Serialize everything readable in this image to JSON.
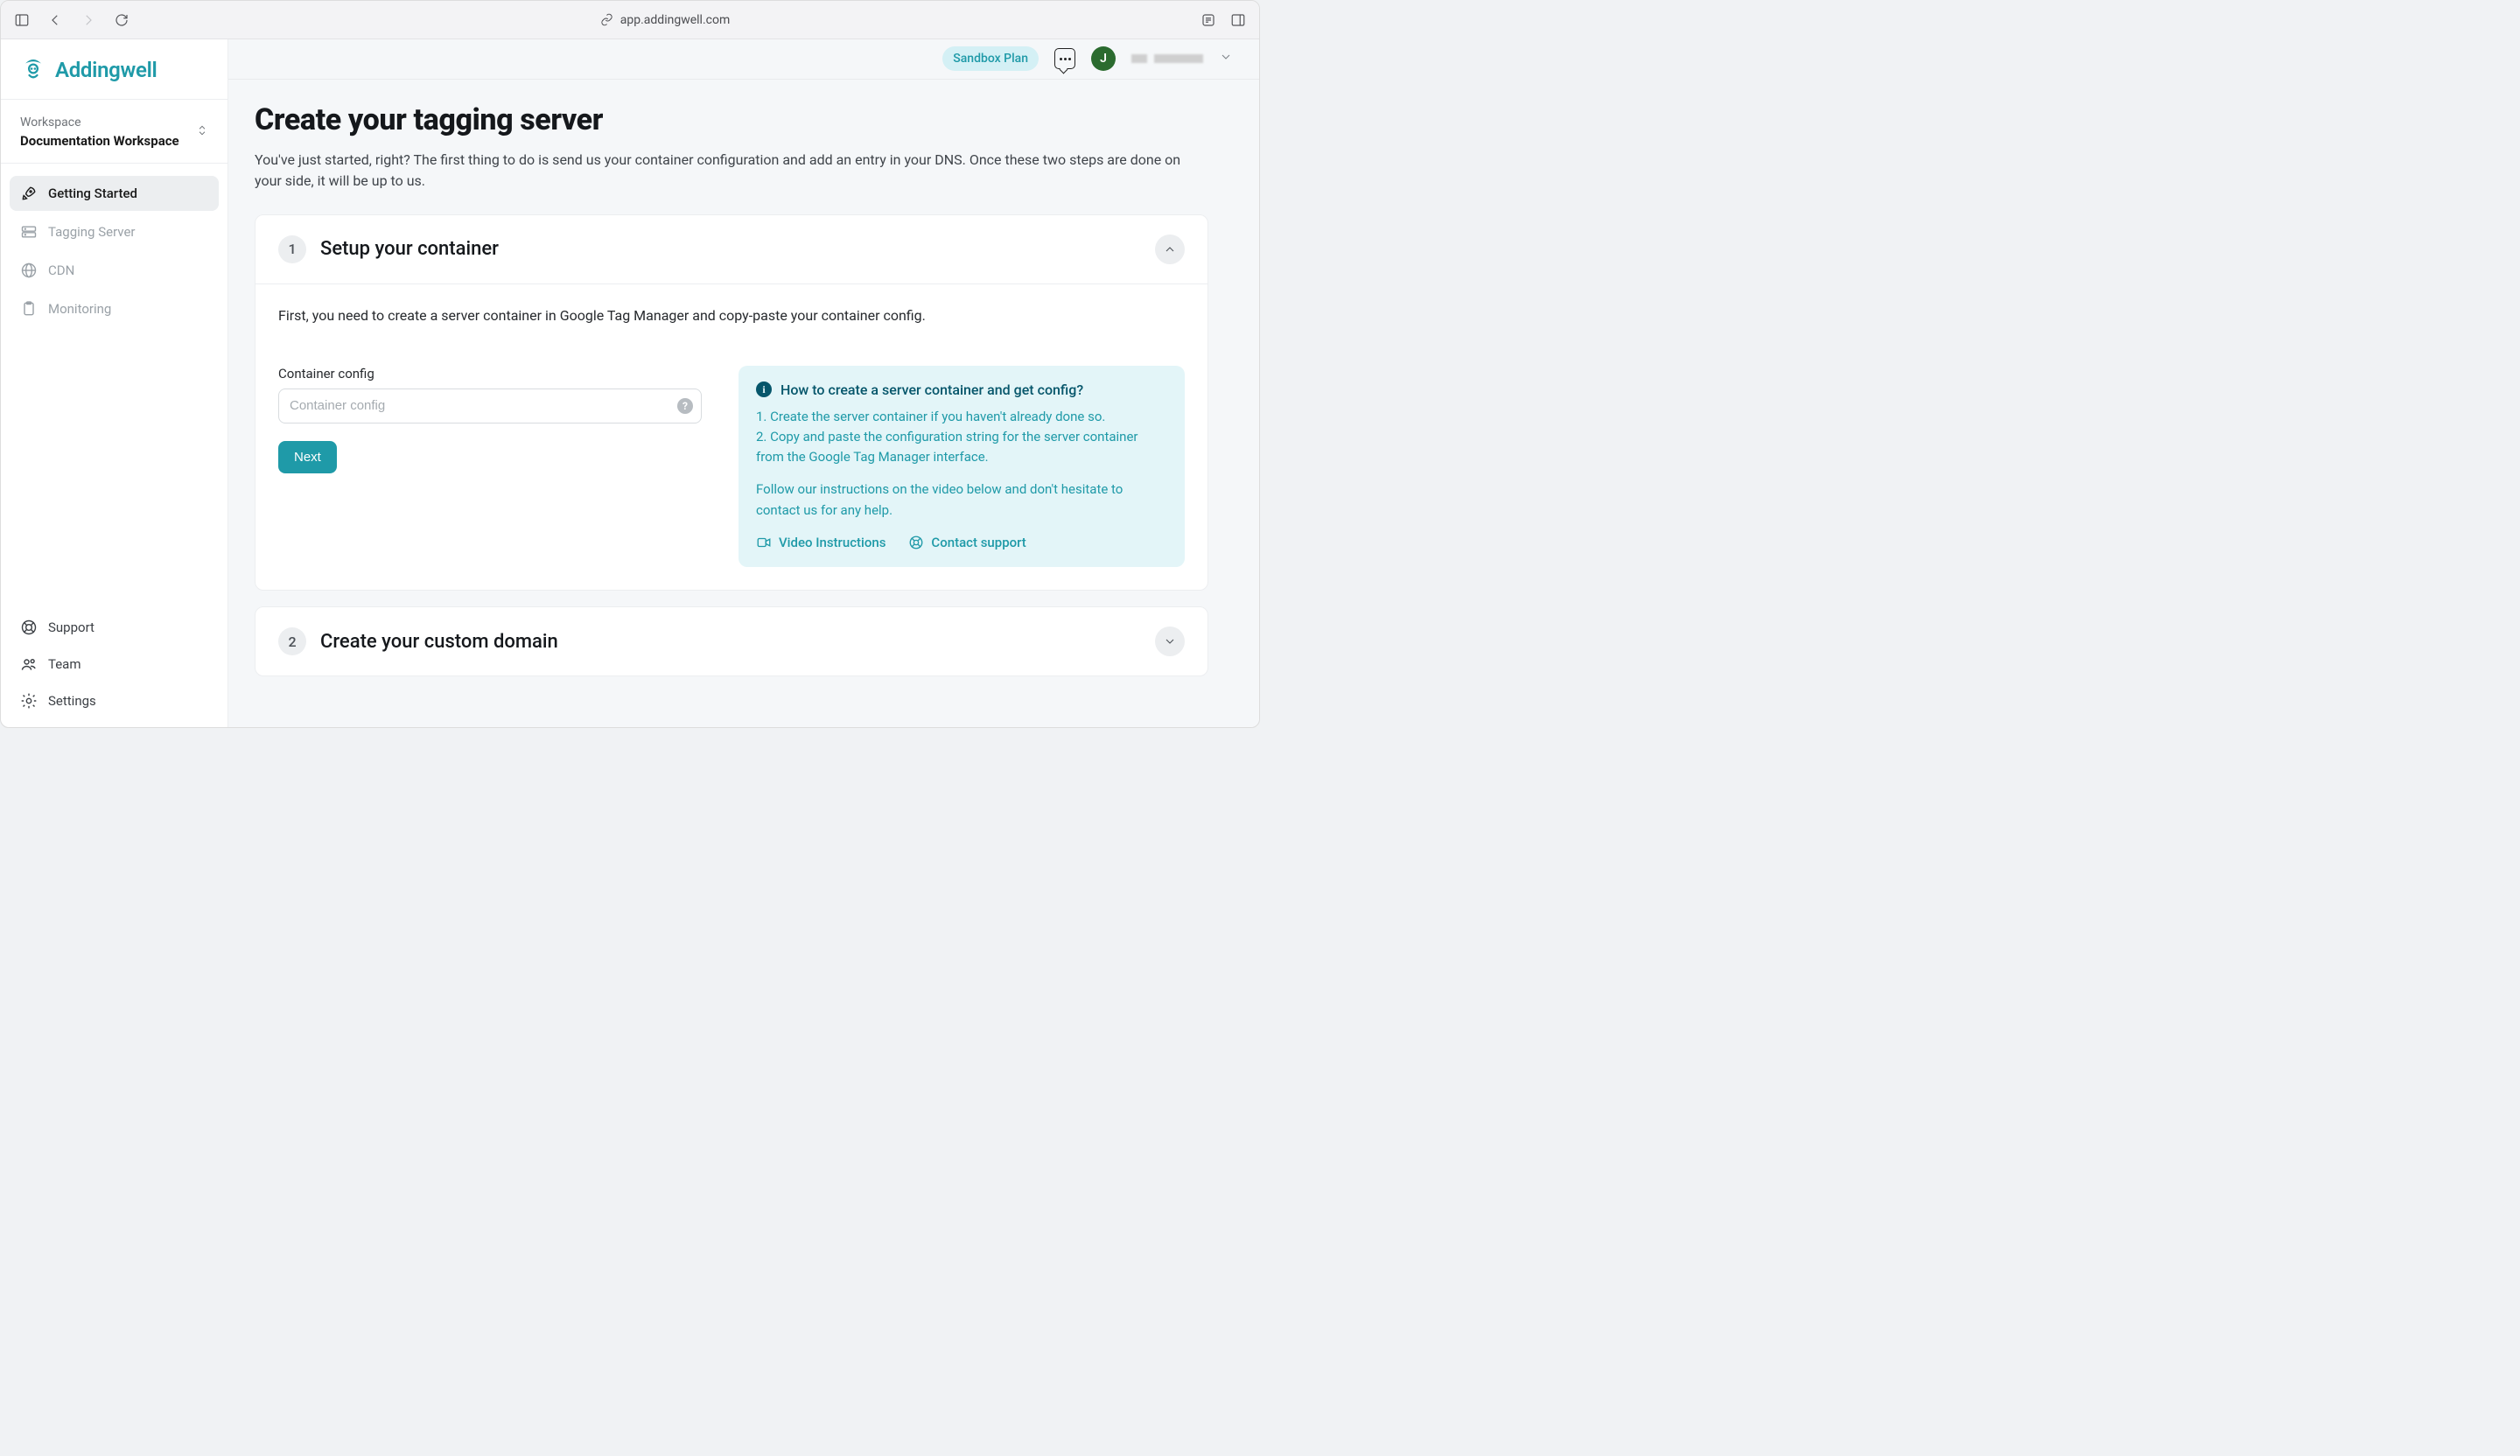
{
  "browser": {
    "url": "app.addingwell.com"
  },
  "brand": {
    "name": "Addingwell",
    "accent": "#1f9aa8"
  },
  "workspace": {
    "label": "Workspace",
    "name": "Documentation Workspace"
  },
  "nav": {
    "items": [
      {
        "id": "getting-started",
        "label": "Getting Started",
        "active": true
      },
      {
        "id": "tagging-server",
        "label": "Tagging Server",
        "active": false
      },
      {
        "id": "cdn",
        "label": "CDN",
        "active": false
      },
      {
        "id": "monitoring",
        "label": "Monitoring",
        "active": false
      }
    ],
    "bottom": [
      {
        "id": "support",
        "label": "Support"
      },
      {
        "id": "team",
        "label": "Team"
      },
      {
        "id": "settings",
        "label": "Settings"
      }
    ]
  },
  "topbar": {
    "plan": "Sandbox Plan",
    "avatar_initial": "J"
  },
  "page": {
    "title": "Create your tagging server",
    "subtitle": "You've just started, right? The first thing to do is send us your container configuration and add an entry in your DNS. Once these two steps are done on your side, it will be up to us."
  },
  "steps": [
    {
      "num": "1",
      "title": "Setup your container",
      "expanded": true,
      "intro": "First, you need to create a server container in Google Tag Manager and copy-paste your container config.",
      "field_label": "Container config",
      "placeholder": "Container config",
      "next_label": "Next",
      "help": {
        "heading": "How to create a server container and get config?",
        "line1": "1. Create the server container if you haven't already done so.",
        "line2": "2. Copy and paste the configuration string for the server container from the Google Tag Manager interface.",
        "tail": "Follow our instructions on the video below and don't hesitate to contact us for any help.",
        "video_label": "Video Instructions",
        "support_label": "Contact support"
      }
    },
    {
      "num": "2",
      "title": "Create your custom domain",
      "expanded": false
    }
  ]
}
